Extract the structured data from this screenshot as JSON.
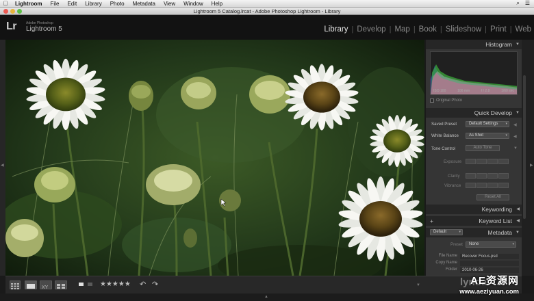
{
  "menubar": {
    "app": "Lightroom",
    "items": [
      "File",
      "Edit",
      "Library",
      "Photo",
      "Metadata",
      "View",
      "Window",
      "Help"
    ]
  },
  "window": {
    "title": "Lightroom 5 Catalog.lrcat - Adobe Photoshop Lightroom - Library"
  },
  "identity": {
    "logo": "Lr",
    "subtitle": "Adobe Photoshop",
    "product": "Lightroom 5"
  },
  "modules": [
    {
      "label": "Library",
      "active": true
    },
    {
      "label": "Develop",
      "active": false
    },
    {
      "label": "Map",
      "active": false
    },
    {
      "label": "Book",
      "active": false
    },
    {
      "label": "Slideshow",
      "active": false
    },
    {
      "label": "Print",
      "active": false
    },
    {
      "label": "Web",
      "active": false
    }
  ],
  "histogram": {
    "title": "Histogram",
    "iso": "ISO 100",
    "focal": "100 mm",
    "aperture": "f / 2.8",
    "shutter": "1/60 sec",
    "original_photo": "Original Photo"
  },
  "quick_develop": {
    "title": "Quick Develop",
    "saved_preset_label": "Saved Preset",
    "saved_preset_value": "Default Settings",
    "white_balance_label": "White Balance",
    "white_balance_value": "As Shot",
    "tone_control_label": "Tone Control",
    "auto_tone": "Auto Tone",
    "exposure": "Exposure",
    "clarity": "Clarity",
    "vibrance": "Vibrance",
    "reset_all": "Reset All"
  },
  "keywording": {
    "title": "Keywording"
  },
  "keyword_list": {
    "title": "Keyword List",
    "plus": "+"
  },
  "metadata": {
    "title": "Metadata",
    "view_select": "Default",
    "preset_label": "Preset",
    "preset_value": "None",
    "file_name_label": "File Name",
    "file_name_value": "Recover Focus.psd",
    "copy_name_label": "Copy Name",
    "copy_name_value": "",
    "folder_label": "Folder",
    "folder_value": "2010-06-26"
  },
  "toolbar": {
    "stars": "★★★★★"
  },
  "watermark": {
    "brand": "AE资源网",
    "url": "www.aeziyuan.com",
    "lynda": "lynda",
    "lynda_sub": ".com"
  },
  "colors": {
    "panel": "#353535",
    "header": "#262626",
    "active_module": "#e6e6e6"
  },
  "menubar_right": {
    "spotlight": "⌕",
    "list": "☰"
  }
}
